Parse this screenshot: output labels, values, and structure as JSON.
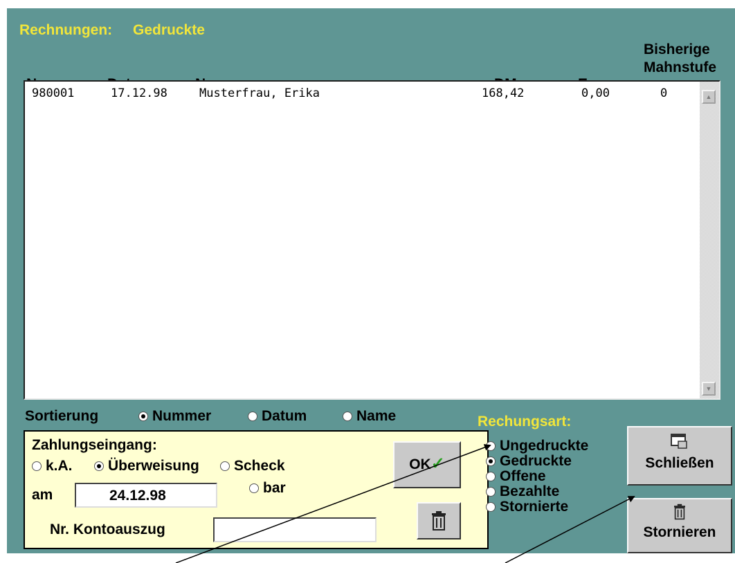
{
  "title": {
    "label": "Rechnungen:",
    "filter": "Gedruckte"
  },
  "columns": {
    "nummer": "Nummer",
    "datum": "Datum",
    "name": "Name",
    "dm": "DM",
    "euro": "Euro",
    "mahnstufe_line1": "Bisherige",
    "mahnstufe_line2": "Mahnstufe"
  },
  "rows": [
    {
      "nummer": "980001",
      "datum": "17.12.98",
      "name": "Musterfrau, Erika",
      "dm": "168,42",
      "euro": "0,00",
      "mahnstufe": "0"
    }
  ],
  "sort": {
    "label": "Sortierung",
    "options": [
      {
        "label": "Nummer",
        "selected": true
      },
      {
        "label": "Datum",
        "selected": false
      },
      {
        "label": "Name",
        "selected": false
      }
    ]
  },
  "payment": {
    "label": "Zahlungseingang:",
    "options": {
      "ka": "k.A.",
      "ueberweisung": "Überweisung",
      "scheck": "Scheck",
      "bar": "bar"
    },
    "selected": "Überweisung",
    "date_label": "am",
    "date_value": "24.12.98",
    "account_label": "Nr. Kontoauszug",
    "account_value": "",
    "ok_label": "OK"
  },
  "invoice_type": {
    "label": "Rechungsart:",
    "options": [
      {
        "label": "Ungedruckte",
        "selected": false
      },
      {
        "label": "Gedruckte",
        "selected": true
      },
      {
        "label": "Offene",
        "selected": false
      },
      {
        "label": "Bezahlte",
        "selected": false
      },
      {
        "label": "Stornierte",
        "selected": false
      }
    ]
  },
  "buttons": {
    "close": "Schließen",
    "cancel": "Stornieren"
  },
  "icons": {
    "close": "window-close-icon",
    "cancel": "trash-icon",
    "delete": "trash-icon",
    "ok": "checkmark-icon"
  },
  "colors": {
    "background": "#5f9694",
    "accent": "#f2e63a",
    "panel": "#ffffd2",
    "check": "#28a020"
  }
}
